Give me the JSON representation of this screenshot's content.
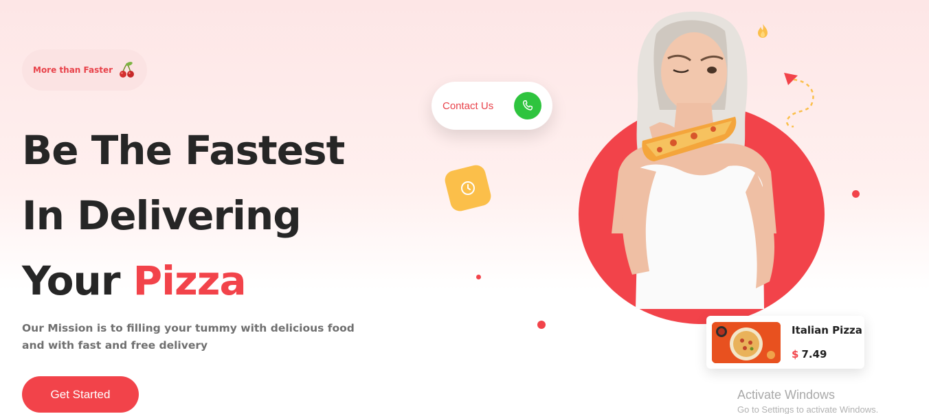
{
  "badge": {
    "label": "More than Faster",
    "icon": "cherry-icon"
  },
  "headline": {
    "line1": "Be The Fastest",
    "line2": "In Delivering",
    "line3_prefix": "Your",
    "line3_accent": "Pizza"
  },
  "mission": "Our Mission is to filling your tummy with delicious food and with fast and free delivery",
  "cta": {
    "label": "Get Started"
  },
  "contact": {
    "label": "Contact Us",
    "icon": "phone-icon"
  },
  "card": {
    "title": "Italian Pizza",
    "currency": "$",
    "price": "7.49"
  },
  "watermark": {
    "title": "Activate Windows",
    "subtitle": "Go to Settings to activate Windows."
  },
  "colors": {
    "accent": "#f2434a",
    "dark": "#262626",
    "phone_green": "#2ec43e",
    "clock_yellow": "#fbbf4a"
  }
}
